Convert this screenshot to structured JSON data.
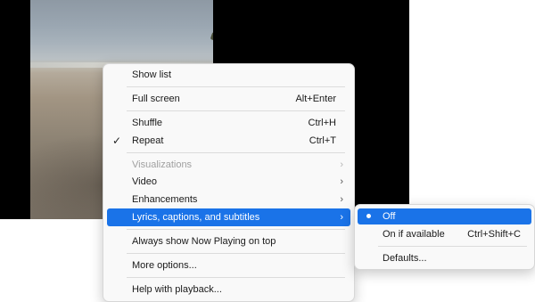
{
  "menu": {
    "show_list": "Show list",
    "full_screen": {
      "label": "Full screen",
      "shortcut": "Alt+Enter"
    },
    "shuffle": {
      "label": "Shuffle",
      "shortcut": "Ctrl+H"
    },
    "repeat": {
      "label": "Repeat",
      "shortcut": "Ctrl+T",
      "checked": true,
      "check_glyph": "✓"
    },
    "visualizations": "Visualizations",
    "video": "Video",
    "enhancements": "Enhancements",
    "lyrics": "Lyrics, captions, and subtitles",
    "always_on_top": "Always show Now Playing on top",
    "more_options": "More options...",
    "help": "Help with playback...",
    "arrow_glyph": "›"
  },
  "submenu": {
    "off": "Off",
    "on_if_available": {
      "label": "On if available",
      "shortcut": "Ctrl+Shift+C"
    },
    "defaults": "Defaults..."
  },
  "colors": {
    "highlight": "#1a73e8",
    "menu_bg": "#f9f9f9",
    "disabled_text": "#a0a0a0"
  },
  "icons": [
    "checkmark-icon",
    "chevron-right-icon",
    "radio-dot-icon"
  ]
}
